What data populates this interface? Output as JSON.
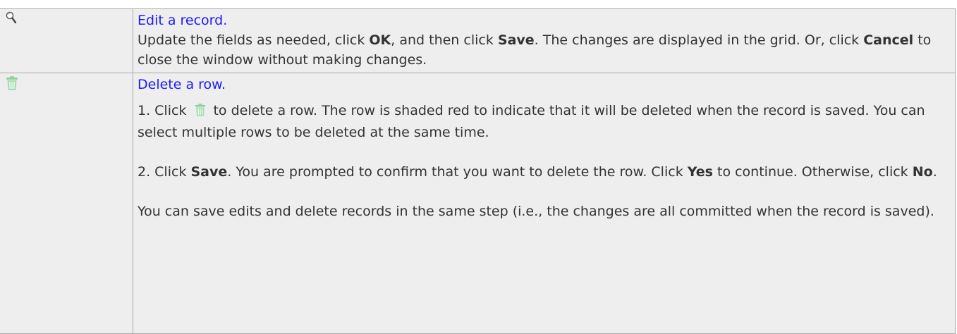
{
  "rows": [
    {
      "icon": "magnifier-icon",
      "title": "Edit a record.",
      "para1": {
        "t1": "Update the fields as needed, click ",
        "b1": "OK",
        "t2": ", and then click ",
        "b2": "Save",
        "t3": ". The changes are displayed in the grid. Or, click ",
        "b3": "Cancel",
        "t4": " to close the window without making changes."
      }
    },
    {
      "icon": "trash-can-icon",
      "title": "Delete a row.",
      "step1": {
        "t1": "1. Click ",
        "t2": "to delete a row. The row is shaded red to indicate that it will be deleted when the record is saved. You can select multiple rows to be deleted at the same time."
      },
      "step2": {
        "t1": "2. Click ",
        "b1": "Save",
        "t2": ". You are prompted to confirm that you want to delete the row. Click ",
        "b2": "Yes",
        "t3": " to continue. Otherwise, click ",
        "b3": "No",
        "t4": "."
      },
      "note": "You can save edits and delete records in the same step (i.e., the changes are all committed when the record is saved)."
    }
  ],
  "colors": {
    "link": "#1a1aff",
    "cell_bg": "#eeeeee",
    "border": "#a8a8a8",
    "trash_icon": "#8fcf9a"
  }
}
